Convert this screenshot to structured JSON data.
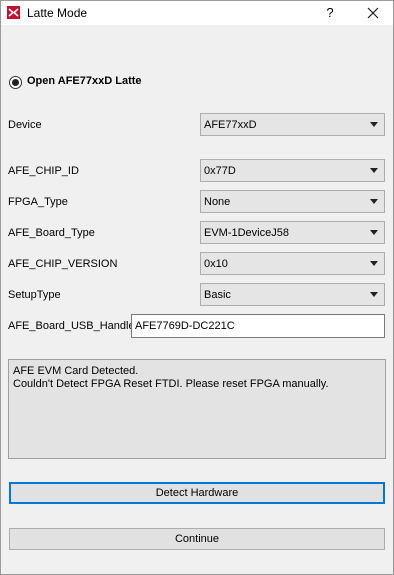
{
  "window": {
    "title": "Latte Mode",
    "help_label": "?",
    "icon": "app-logo-icon"
  },
  "mode": {
    "radio_label": "Open AFE77xxD Latte",
    "selected": true
  },
  "fields": {
    "device": {
      "label": "Device",
      "value": "AFE77xxD"
    },
    "chip_id": {
      "label": "AFE_CHIP_ID",
      "value": "0x77D"
    },
    "fpga_type": {
      "label": "FPGA_Type",
      "value": "None"
    },
    "board_type": {
      "label": "AFE_Board_Type",
      "value": "EVM-1DeviceJ58"
    },
    "chip_version": {
      "label": "AFE_CHIP_VERSION",
      "value": "0x10"
    },
    "setup_type": {
      "label": "SetupType",
      "value": "Basic"
    },
    "usb_handle": {
      "label": "AFE_Board_USB_Handle",
      "value": "AFE7769D-DC221C"
    }
  },
  "log": {
    "line1": "AFE EVM Card Detected.",
    "line2": "Couldn't Detect FPGA Reset FTDI. Please reset FPGA manually."
  },
  "buttons": {
    "detect": "Detect Hardware",
    "continue": "Continue"
  }
}
